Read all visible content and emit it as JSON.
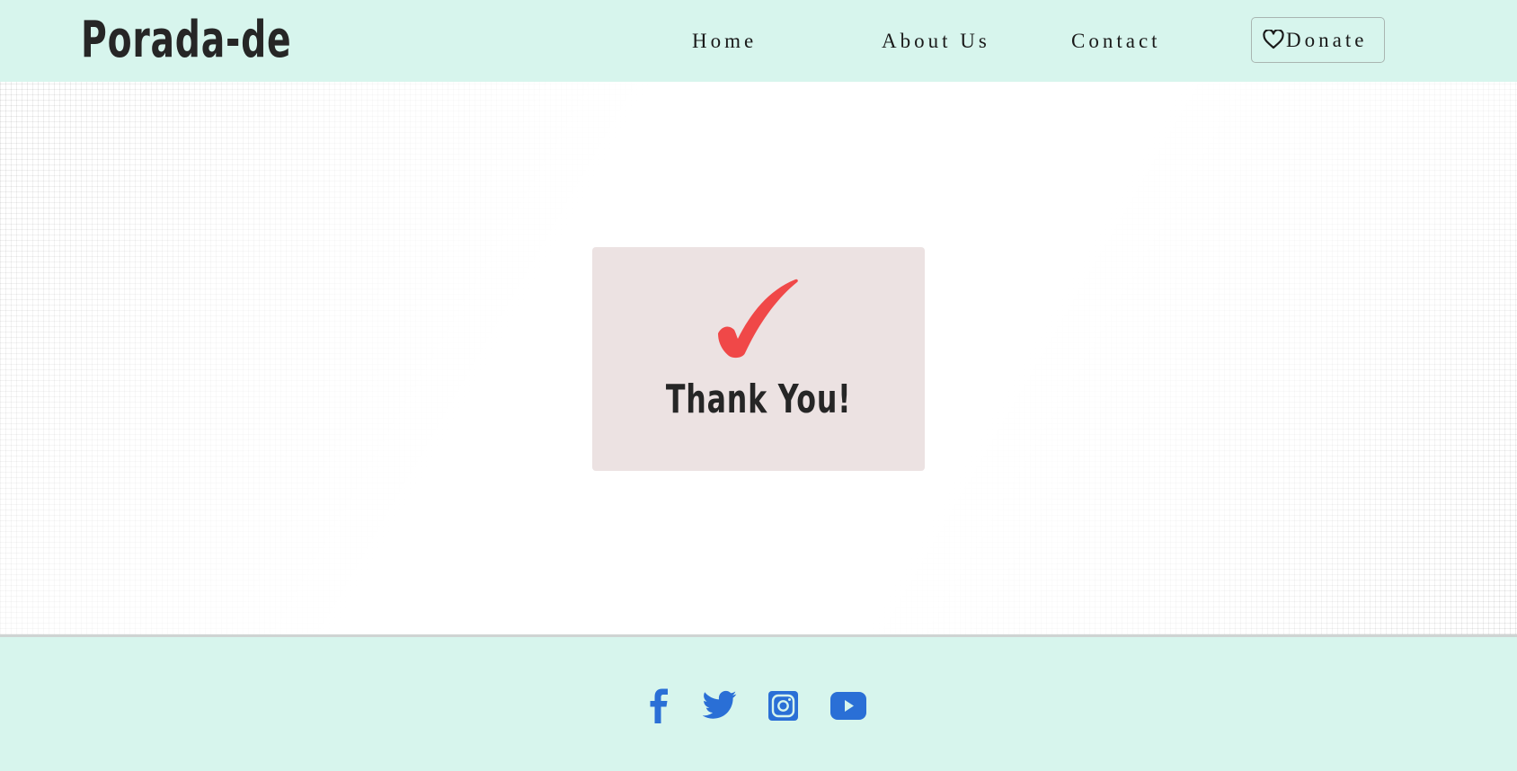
{
  "header": {
    "brand": "Porada-de",
    "nav": [
      {
        "label": "Home"
      },
      {
        "label": "About Us"
      },
      {
        "label": "Contact"
      }
    ],
    "donate": {
      "label": "Donate",
      "icon": "heart-outline-icon"
    }
  },
  "main": {
    "card": {
      "icon": "checkmark-icon",
      "icon_color": "#f04848",
      "message": "Thank You!"
    }
  },
  "footer": {
    "social": [
      {
        "name": "facebook",
        "icon": "facebook-icon"
      },
      {
        "name": "twitter",
        "icon": "twitter-icon"
      },
      {
        "name": "instagram",
        "icon": "instagram-icon"
      },
      {
        "name": "youtube",
        "icon": "youtube-icon"
      }
    ],
    "icon_color": "#2a6fd6"
  },
  "colors": {
    "header_bg": "#d7f5ed",
    "card_bg": "#ece2e2",
    "text": "#262626"
  }
}
